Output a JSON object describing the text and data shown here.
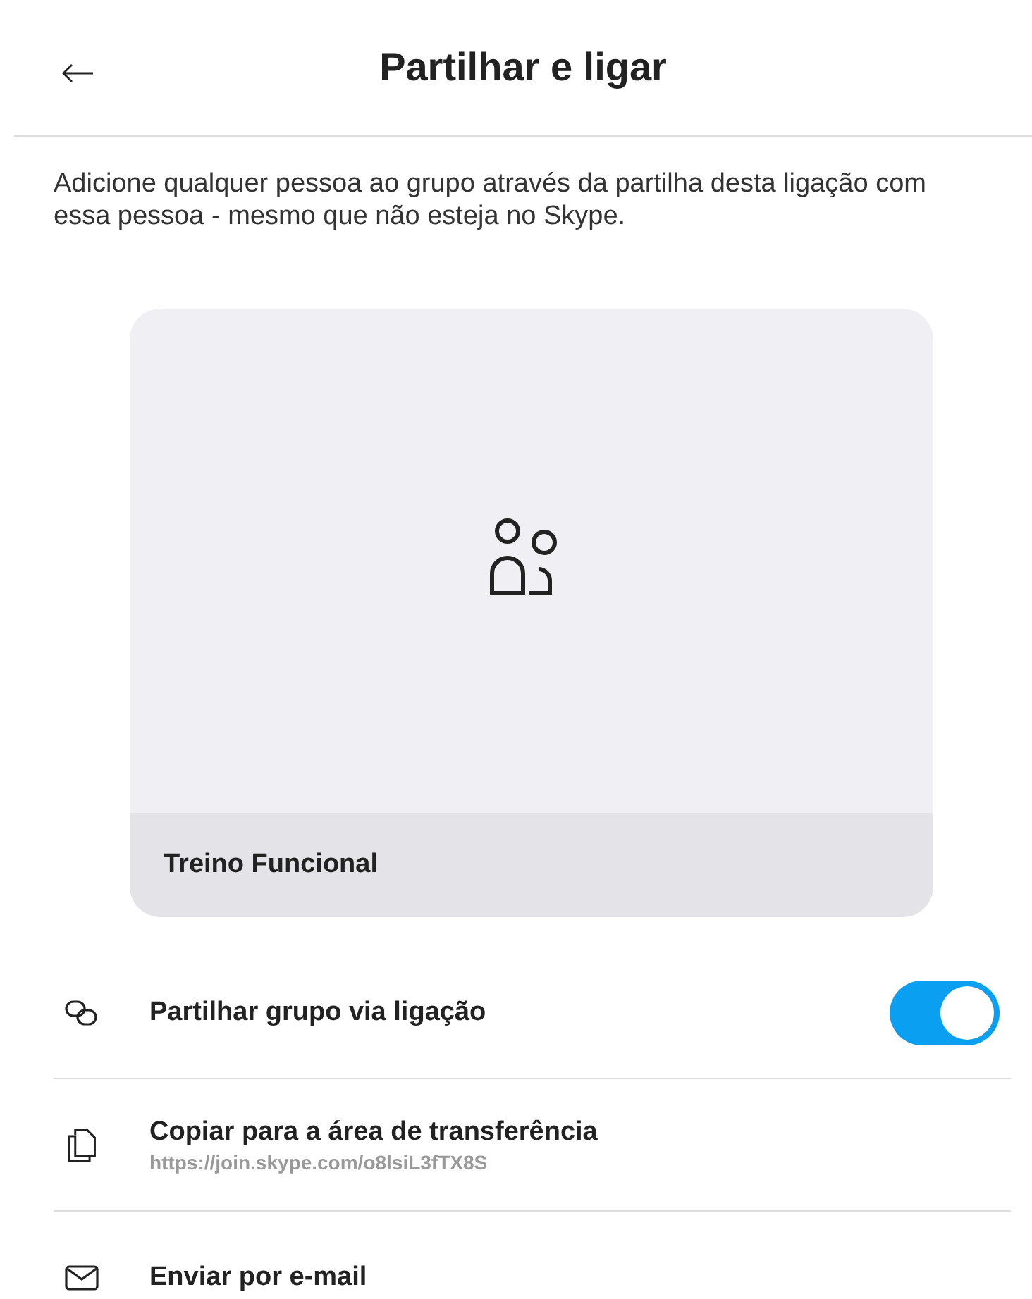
{
  "header": {
    "title": "Partilhar e ligar"
  },
  "description": "Adicione qualquer pessoa ao grupo através da partilha desta ligação com essa pessoa - mesmo que não esteja no Skype.",
  "group_card": {
    "name": "Treino Funcional"
  },
  "options": [
    {
      "kind": "toggle",
      "label": "Partilhar grupo via ligação",
      "on": true
    },
    {
      "kind": "action",
      "label": "Copiar para a área de transferência",
      "subtitle": "https://join.skype.com/o8lsiL3fTX8S"
    },
    {
      "kind": "action",
      "label": "Enviar por e-mail"
    }
  ]
}
